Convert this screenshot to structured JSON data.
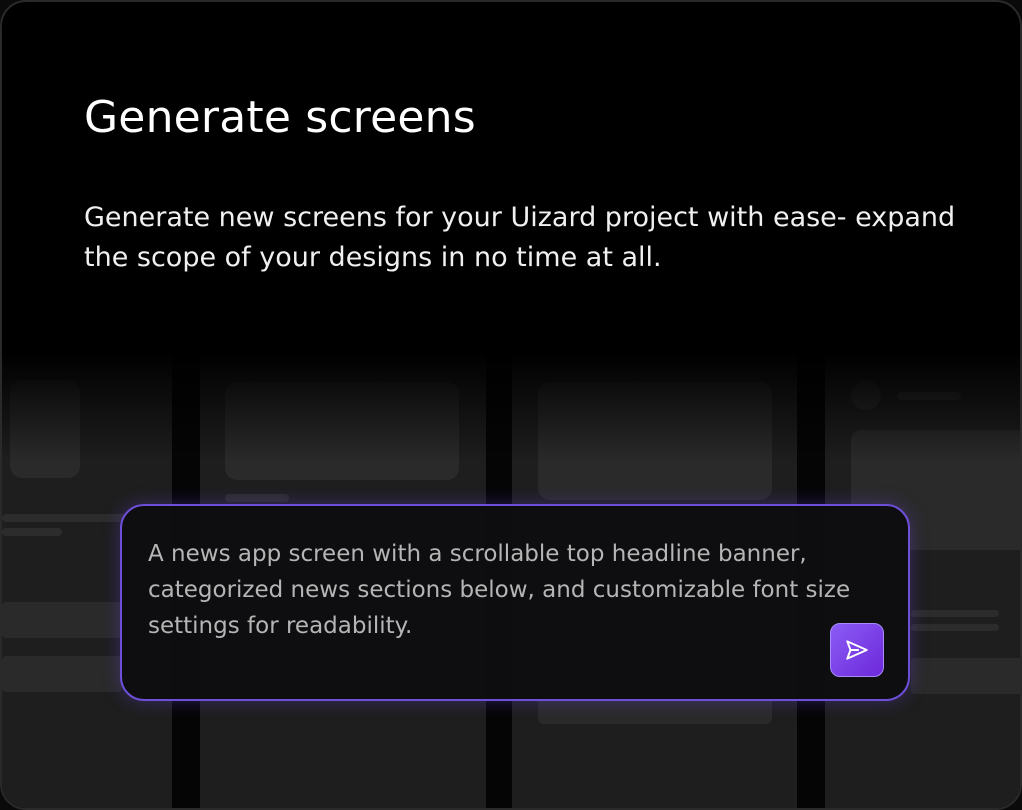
{
  "card": {
    "title": "Generate screens",
    "description": "Generate new screens for your Uizard project with ease- expand the scope of your designs in no time at all."
  },
  "prompt": {
    "text": "A news app screen with a scrollable top headline banner, categorized news sections below, and customizable font size settings for readability.",
    "send_icon": "send-icon"
  },
  "colors": {
    "accent": "#7c3aed",
    "background": "#000000",
    "text": "#ffffff"
  }
}
